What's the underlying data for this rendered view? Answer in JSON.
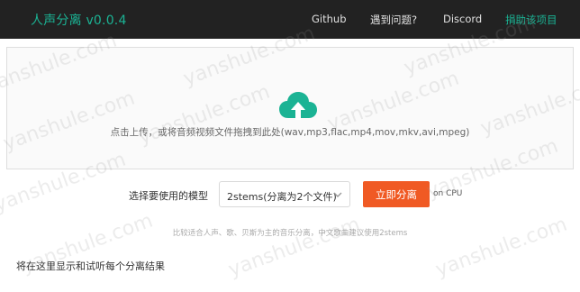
{
  "header": {
    "brand": "人声分离 v0.0.4",
    "nav": [
      "Github",
      "遇到问题?",
      "Discord",
      "捐助该项目"
    ]
  },
  "upload": {
    "prompt": "点击上传，或将音频视频文件拖拽到此处(wav,mp3,flac,mp4,mov,mkv,avi,mpeg)",
    "icon": "cloud-upload-icon"
  },
  "model": {
    "label": "选择要使用的模型",
    "selected": "2stems(分离为2个文件)",
    "run_button": "立即分离",
    "device": "on CPU"
  },
  "hint": "比较适合人声、歌、贝斯为主的音乐分离，中文歌曲建议使用2stems",
  "results": {
    "label": "将在这里显示和试听每个分离结果"
  },
  "watermark": "yanshule.com",
  "colors": {
    "header_bg": "#222222",
    "brand": "#1bb394",
    "button": "#f05a24"
  }
}
